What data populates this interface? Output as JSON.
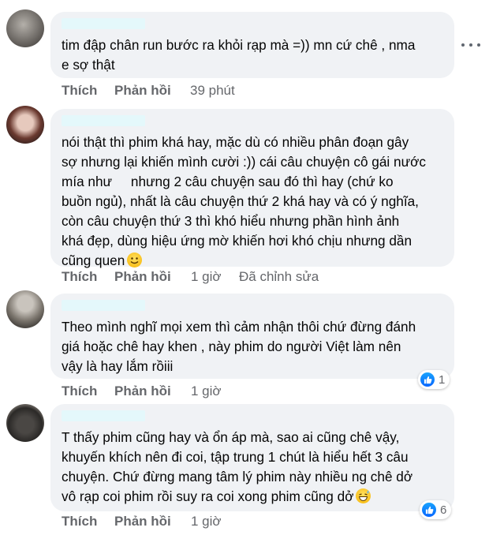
{
  "colors": {
    "bubble_bg": "#f0f2f5",
    "action_text": "#65676b",
    "like_blue": "#0866ff",
    "name_redacted": "#e4f8fb"
  },
  "comments": [
    {
      "text": "tim đập chân run bước ra khỏi rạp mà =)) mn cứ chê , nma\ne sợ thật",
      "actions": {
        "like": "Thích",
        "reply": "Phản hồi",
        "time": "39 phút"
      }
    },
    {
      "text": "nói thật thì phim khá hay, mặc dù có nhiều phân đoạn gây\nsợ nhưng lại khiến mình cười :)) cái câu chuyện cô gái nước\nmía như     nhưng 2 câu chuyện sau đó thì hay (chứ ko\nbuồn ngủ), nhất là câu chuyện thứ 2 khá hay và có ý nghĩa,\ncòn câu chuyện thứ 3 thì khó hiểu nhưng phần hình ảnh\nkhá đẹp, dùng hiệu ứng mờ khiến hơi khó chịu nhưng dần\ncũng quen",
      "emoji": "smile-emoji",
      "actions": {
        "like": "Thích",
        "reply": "Phản hồi",
        "time": "1 giờ",
        "edited": "Đã chỉnh sửa"
      }
    },
    {
      "text": "Theo mình nghĩ mọi xem thì cảm nhận thôi chứ đừng đánh\ngiá hoặc chê hay khen , này phim do người Việt làm nên\nvậy là hay lắm rồiii",
      "reaction": {
        "icon": "like-icon",
        "count": "1"
      },
      "actions": {
        "like": "Thích",
        "reply": "Phản hồi",
        "time": "1 giờ"
      }
    },
    {
      "text": "T thấy phim cũng hay và ổn áp mà, sao ai cũng chê vậy,\nkhuyến khích nên đi coi, tập trung 1 chút là hiểu hết 3 câu\nchuyện. Chứ đừng mang tâm lý phim này nhiều ng chê dở\nvô rạp coi phim rồi suy ra coi xong phim cũng dở",
      "emoji": "grin-sweat-emoji",
      "reaction": {
        "icon": "like-icon",
        "count": "6"
      },
      "actions": {
        "like": "Thích",
        "reply": "Phản hồi",
        "time": "1 giờ"
      }
    }
  ]
}
